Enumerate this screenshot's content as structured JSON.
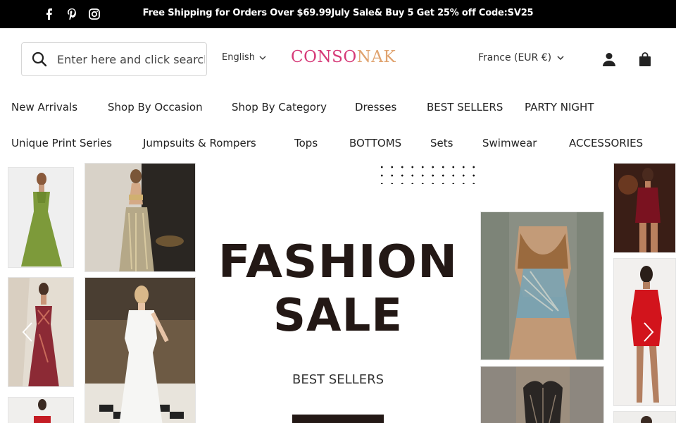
{
  "announcement": {
    "text": "Free Shipping for Orders Over $69.99July Sale& Buy 5 Get 25% off Code:SV25",
    "social_icons": [
      "facebook-icon",
      "pinterest-icon",
      "instagram-icon"
    ]
  },
  "header": {
    "search_placeholder": "Enter here and click search",
    "language": "English",
    "logo_main": "CONSO",
    "logo_tail": "NAK",
    "currency": "France (EUR €)"
  },
  "nav": {
    "row1": [
      "New Arrivals",
      "Shop By Occasion",
      "Shop By Category",
      "Dresses",
      "BEST SELLERS",
      "PARTY NIGHT"
    ],
    "row2": [
      "Unique Print Series",
      "Jumpsuits & Rompers",
      "Tops",
      "BOTTOMS",
      "Sets",
      "Swimwear",
      "ACCESSORIES"
    ]
  },
  "hero": {
    "title_line1": "FASHION",
    "title_line2": "SALE",
    "subtitle": "BEST SELLERS"
  },
  "colors": {
    "announcement_bg": "#000000",
    "logo_pink": "#d63a78",
    "logo_gold": "#e0a36f",
    "title": "#231815"
  }
}
